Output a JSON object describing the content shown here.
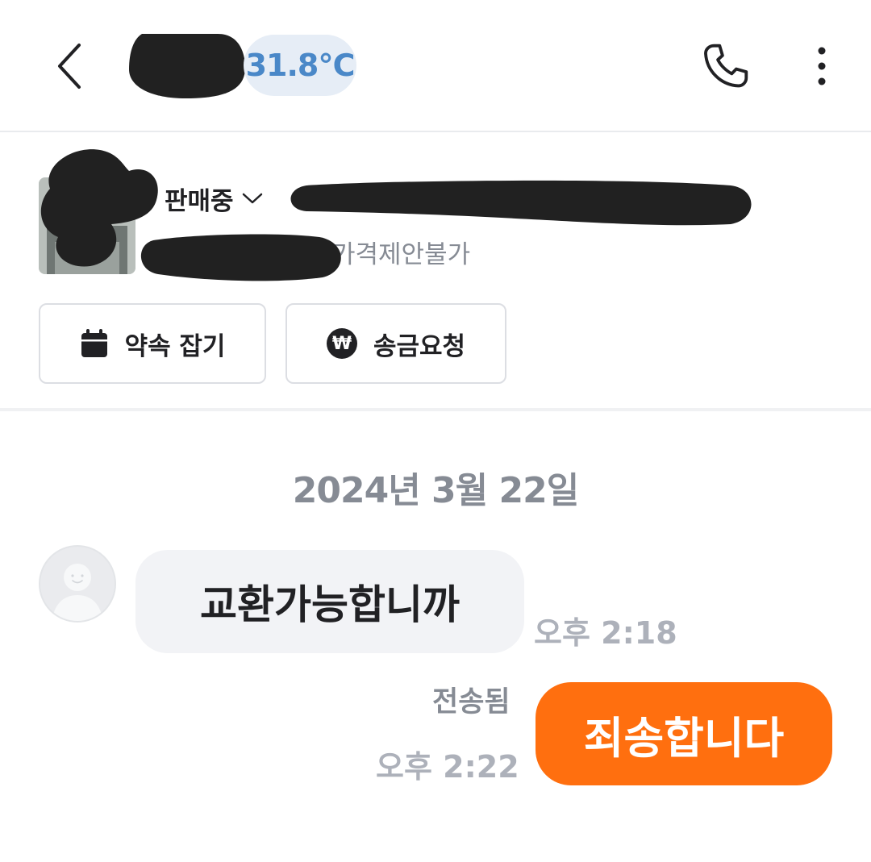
{
  "header": {
    "back_icon": "chevron-left-icon",
    "manner_temperature": "31.8℃",
    "call_icon": "phone-icon",
    "more_icon": "more-vertical-icon"
  },
  "product": {
    "status": "판매중",
    "price_note": "가격제안불가",
    "buttons": {
      "appointment": "약속 잡기",
      "money_request": "송금요청"
    }
  },
  "chat": {
    "date": "2024년 3월 22일",
    "messages": [
      {
        "side": "in",
        "text": "교환가능합니까",
        "time": "오후 2:18"
      },
      {
        "side": "out",
        "text": "죄송합니다",
        "status": "전송됨",
        "time": "오후 2:22"
      }
    ]
  },
  "colors": {
    "accent_orange": "#ff6f0f",
    "temperature_blue": "#4a88c8",
    "incoming_bubble": "#f2f3f6"
  }
}
